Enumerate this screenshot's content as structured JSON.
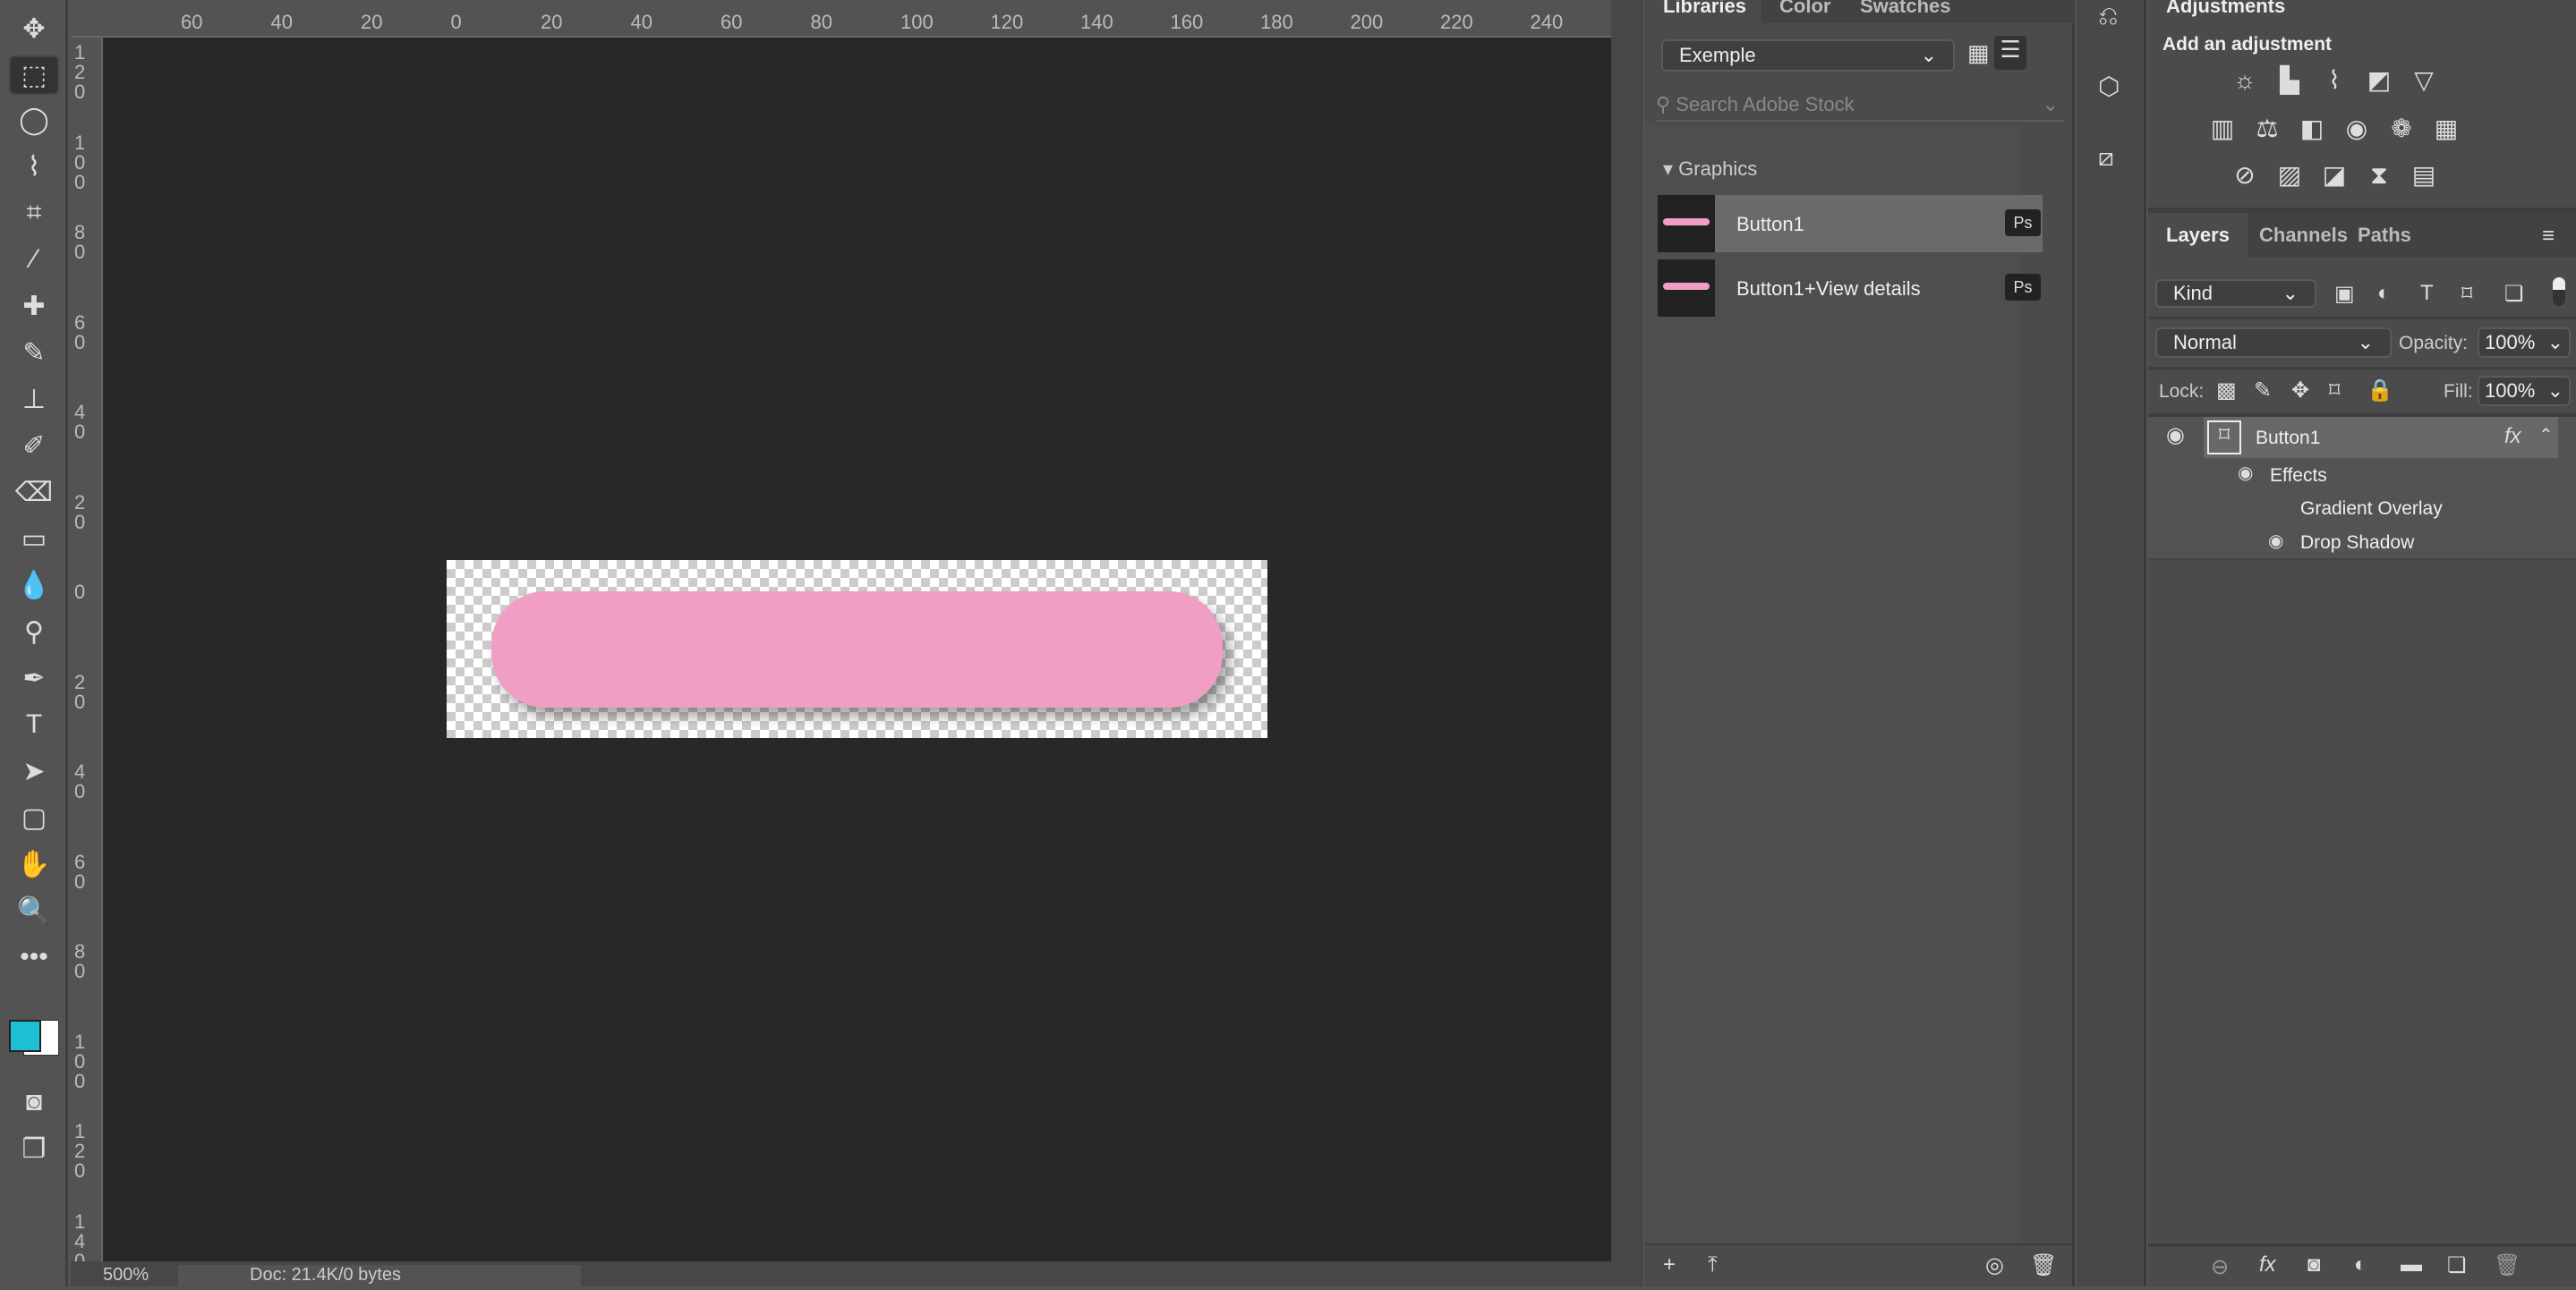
{
  "toolbar": {
    "tools": [
      "move",
      "rectangular-marquee",
      "lasso",
      "quick-selection",
      "crop",
      "eyedropper",
      "healing-brush",
      "brush",
      "clone-stamp",
      "history-brush",
      "eraser",
      "gradient",
      "blur",
      "dodge",
      "pen",
      "type",
      "path-selection",
      "rectangle",
      "hand",
      "zoom",
      "more"
    ],
    "foreground_color": "#1ec0d6",
    "background_color": "#ffffff"
  },
  "rulers": {
    "horizontal": [
      "60",
      "40",
      "20",
      "0",
      "20",
      "40",
      "60",
      "80",
      "100",
      "120",
      "140",
      "160",
      "180",
      "200",
      "220",
      "240"
    ],
    "vertical": [
      "120",
      "100",
      "80",
      "60",
      "40",
      "20",
      "0",
      "20",
      "40",
      "60",
      "80",
      "100",
      "120",
      "140"
    ]
  },
  "canvas": {
    "button_color": "#f19ec4"
  },
  "status": {
    "zoom": "500%",
    "doc": "Doc: 21.4K/0 bytes"
  },
  "libraries": {
    "tabs": [
      "Libraries",
      "Color",
      "Swatches"
    ],
    "library": "Exemple",
    "search_placeholder": "Search Adobe Stock",
    "section": "Graphics",
    "items": [
      {
        "name": "Button1",
        "badge": "Ps"
      },
      {
        "name": "Button1+View details",
        "badge": "Ps"
      }
    ]
  },
  "adjustments": {
    "tab": "Adjustments",
    "heading": "Add an adjustment"
  },
  "layers": {
    "tabs": [
      "Layers",
      "Channels",
      "Paths"
    ],
    "filter": "Kind",
    "blend_mode": "Normal",
    "opacity_label": "Opacity:",
    "opacity": "100%",
    "lock_label": "Lock:",
    "fill_label": "Fill:",
    "fill": "100%",
    "layer_name": "Button1",
    "fx": "fx",
    "effects_label": "Effects",
    "effects": [
      "Gradient Overlay",
      "Drop Shadow"
    ]
  }
}
